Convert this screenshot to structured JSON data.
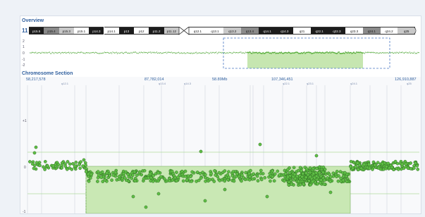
{
  "overview": {
    "title": "Overview",
    "chromosome": "11",
    "bands": [
      {
        "label": "p15.5",
        "shade": "dark"
      },
      {
        "label": "p15.4",
        "shade": "gray"
      },
      {
        "label": "p15.3",
        "shade": "light"
      },
      {
        "label": "p15.1",
        "shade": "white"
      },
      {
        "label": "p14.3",
        "shade": "dark"
      },
      {
        "label": "p14.1",
        "shade": "white"
      },
      {
        "label": "p13",
        "shade": "dark"
      },
      {
        "label": "p12",
        "shade": "white"
      },
      {
        "label": "p11.2",
        "shade": "dark"
      },
      {
        "label": "p11.12",
        "shade": "light"
      },
      {
        "label": "q12.1",
        "shade": "white"
      },
      {
        "label": "q13.1",
        "shade": "white"
      },
      {
        "label": "q13.2",
        "shade": "light"
      },
      {
        "label": "q13.4",
        "shade": "gray"
      },
      {
        "label": "q14.1",
        "shade": "dark"
      },
      {
        "label": "q14.3",
        "shade": "dark"
      },
      {
        "label": "q21",
        "shade": "white"
      },
      {
        "label": "q22.1",
        "shade": "dark"
      },
      {
        "label": "q22.3",
        "shade": "dark"
      },
      {
        "label": "q23.3",
        "shade": "white"
      },
      {
        "label": "q24.1",
        "shade": "gray"
      },
      {
        "label": "q24.2",
        "shade": "white"
      },
      {
        "label": "q25",
        "shade": "light"
      }
    ],
    "y_ticks": [
      "2",
      "1",
      "0",
      "-1",
      "-2"
    ],
    "highlight_color": "#c6e6b0"
  },
  "section": {
    "title": "Chromosome Section",
    "coordinates": [
      "58,217,578",
      "87,782,014",
      "58.89Mb",
      "107,346,451",
      "126,910,887"
    ],
    "band_labels": [
      "q12.1",
      "q13.4",
      "q14.3",
      "q22.1",
      "q23.1",
      "q24.1",
      "q25"
    ],
    "y_ticks": [
      "+1",
      "0",
      "-1"
    ],
    "point_color": "#4caf3a",
    "region_color": "#c9e8b4"
  }
}
